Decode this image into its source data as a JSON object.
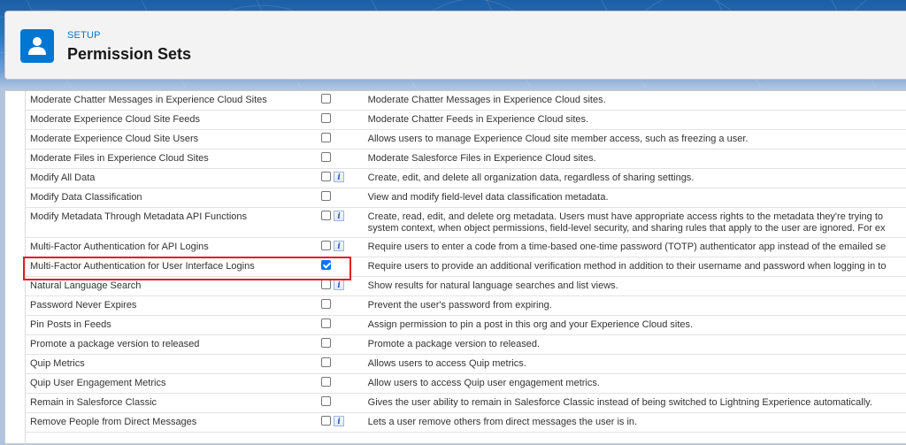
{
  "header": {
    "eyebrow": "SETUP",
    "title": "Permission Sets"
  },
  "colors": {
    "brand": "#0176d3",
    "highlight_border": "#e0201e",
    "checkbox_on": "#0075ff"
  },
  "permissions": [
    {
      "name": "Moderate Chatter Messages in Experience Cloud Sites",
      "checked": false,
      "info": false,
      "description": "Moderate Chatter Messages in Experience Cloud sites."
    },
    {
      "name": "Moderate Experience Cloud Site Feeds",
      "checked": false,
      "info": false,
      "description": "Moderate Chatter Feeds in Experience Cloud sites."
    },
    {
      "name": "Moderate Experience Cloud Site Users",
      "checked": false,
      "info": false,
      "description": "Allows users to manage Experience Cloud site member access, such as freezing a user."
    },
    {
      "name": "Moderate Files in Experience Cloud Sites",
      "checked": false,
      "info": false,
      "description": "Moderate Salesforce Files in Experience Cloud sites."
    },
    {
      "name": "Modify All Data",
      "checked": false,
      "info": true,
      "description": "Create, edit, and delete all organization data, regardless of sharing settings."
    },
    {
      "name": "Modify Data Classification",
      "checked": false,
      "info": false,
      "description": "View and modify field-level data classification metadata."
    },
    {
      "name": "Modify Metadata Through Metadata API Functions",
      "checked": false,
      "info": true,
      "description": "Create, read, edit, and delete org metadata. Users must have appropriate access rights to the metadata they're trying to",
      "description2": "system context, when object permissions, field-level security, and sharing rules that apply to the user are ignored. For ex"
    },
    {
      "name": "Multi-Factor Authentication for API Logins",
      "checked": false,
      "info": true,
      "description": "Require users to enter a code from a time-based one-time password (TOTP) authenticator app instead of the emailed se"
    },
    {
      "name": "Multi-Factor Authentication for User Interface Logins",
      "checked": true,
      "info": false,
      "description": "Require users to provide an additional verification method in addition to their username and password when logging in to"
    },
    {
      "name": "Natural Language Search",
      "checked": false,
      "info": true,
      "description": "Show results for natural language searches and list views."
    },
    {
      "name": "Password Never Expires",
      "checked": false,
      "info": false,
      "description": "Prevent the user's password from expiring."
    },
    {
      "name": "Pin Posts in Feeds",
      "checked": false,
      "info": false,
      "description": "Assign permission to pin a post in this org and your Experience Cloud sites."
    },
    {
      "name": "Promote a package version to released",
      "checked": false,
      "info": false,
      "description": "Promote a package version to released."
    },
    {
      "name": "Quip Metrics",
      "checked": false,
      "info": false,
      "description": "Allows users to access Quip metrics."
    },
    {
      "name": "Quip User Engagement Metrics",
      "checked": false,
      "info": false,
      "description": "Allow users to access Quip user engagement metrics."
    },
    {
      "name": "Remain in Salesforce Classic",
      "checked": false,
      "info": false,
      "description": "Gives the user ability to remain in Salesforce Classic instead of being switched to Lightning Experience automatically."
    },
    {
      "name": "Remove People from Direct Messages",
      "checked": false,
      "info": true,
      "description": "Lets a user remove others from direct messages the user is in."
    }
  ]
}
